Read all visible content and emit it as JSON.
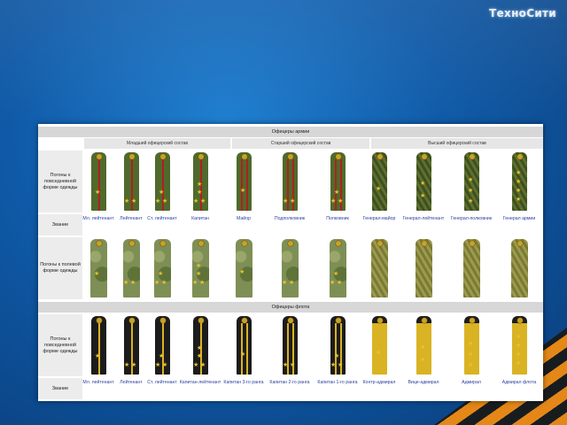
{
  "logo": "ТехноСити",
  "army": {
    "title": "Офицеры армии",
    "groups": [
      "Младший офицерский состав",
      "Старший офицерский состав",
      "Высший офицерский состав"
    ],
    "row_labels": {
      "everyday": "Погоны к повседневной форме одежды",
      "rank": "Звание",
      "field": "Погоны к полевой форме одежды"
    },
    "ranks": [
      "Мл. лейтенант",
      "Лейтенант",
      "Ст. лейтенант",
      "Капитан",
      "Майор",
      "Подполковник",
      "Полковник",
      "Генерал-майор",
      "Генерал-лейтенант",
      "Генерал-полковник",
      "Генерал армии"
    ]
  },
  "navy": {
    "title": "Офицеры флота",
    "row_labels": {
      "everyday": "Погоны к повседневной форме одежды",
      "rank": "Звание"
    },
    "ranks": [
      "Мл. лейтенант",
      "Лейтенант",
      "Ст. лейтенант",
      "Капитан-лейтенант",
      "Капитан 3-го ранга",
      "Капитан 2-го ранга",
      "Капитан 1-го ранга",
      "Контр-адмирал",
      "Вице-адмирал",
      "Адмирал",
      "Адмирал флота"
    ]
  },
  "colors": {
    "army_green": "#4f6a2c",
    "army_stripe": "#b0201e",
    "field_camo": "#7e8f55",
    "general_gold": "#b59a2e",
    "navy_black": "#1c1c1c",
    "navy_stripe": "#d9b323",
    "star": "#e8c22a",
    "background": "#0f5aa8"
  },
  "icons": [
    "star-icon",
    "button-icon"
  ]
}
